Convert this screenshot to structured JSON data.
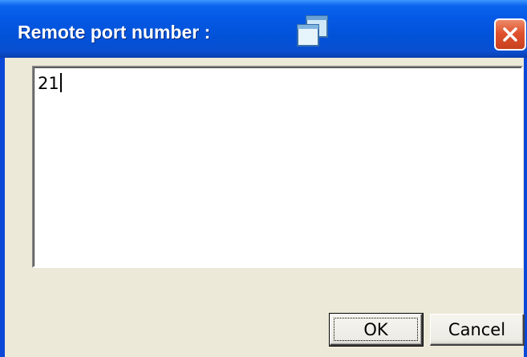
{
  "window": {
    "title": "Remote port number :",
    "app_icon": "overlapping-windows-icon",
    "close_icon": "close-icon",
    "colors": {
      "titlebar": "#0458e3",
      "close_button": "#e0522e",
      "face": "#ece9d8"
    }
  },
  "input": {
    "value": "21"
  },
  "buttons": {
    "ok_label": "OK",
    "cancel_label": "Cancel"
  }
}
